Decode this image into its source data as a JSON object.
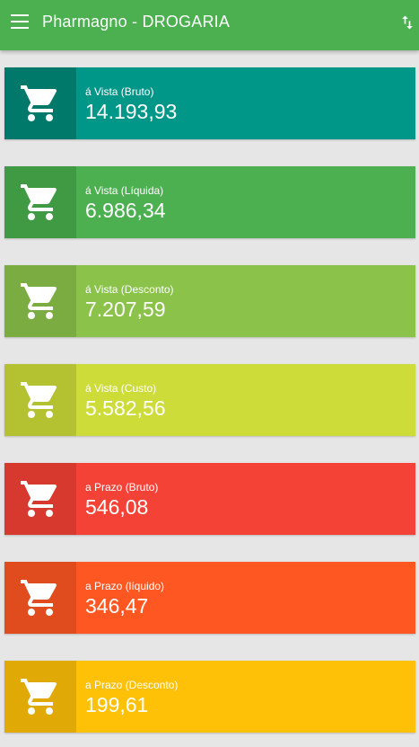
{
  "appbar": {
    "title": "Pharmagno - DROGARIA"
  },
  "cards": [
    {
      "label": "á Vista (Bruto)",
      "value": "14.193,93",
      "color": "#009688",
      "icon_bg": "#00796b"
    },
    {
      "label": "á Vista (Líquida)",
      "value": "6.986,34",
      "color": "#4caf50",
      "icon_bg": "#3f9a43"
    },
    {
      "label": "á Vista (Desconto)",
      "value": "7.207,59",
      "color": "#8bc34a",
      "icon_bg": "#7aac42"
    },
    {
      "label": "á Vista (Custo)",
      "value": "5.582,56",
      "color": "#cddc39",
      "icon_bg": "#b4c232"
    },
    {
      "label": "a Prazo (Bruto)",
      "value": "546,08",
      "color": "#f44336",
      "icon_bg": "#d7392f"
    },
    {
      "label": "a Prazo (líquido)",
      "value": "346,47",
      "color": "#ff5722",
      "icon_bg": "#e04c1e"
    },
    {
      "label": "a Prazo (Desconto)",
      "value": "199,61",
      "color": "#ffc107",
      "icon_bg": "#e0a906"
    }
  ],
  "icons": {
    "menu": "menu-icon",
    "sort": "sort-icon",
    "card": "cart-icon"
  }
}
